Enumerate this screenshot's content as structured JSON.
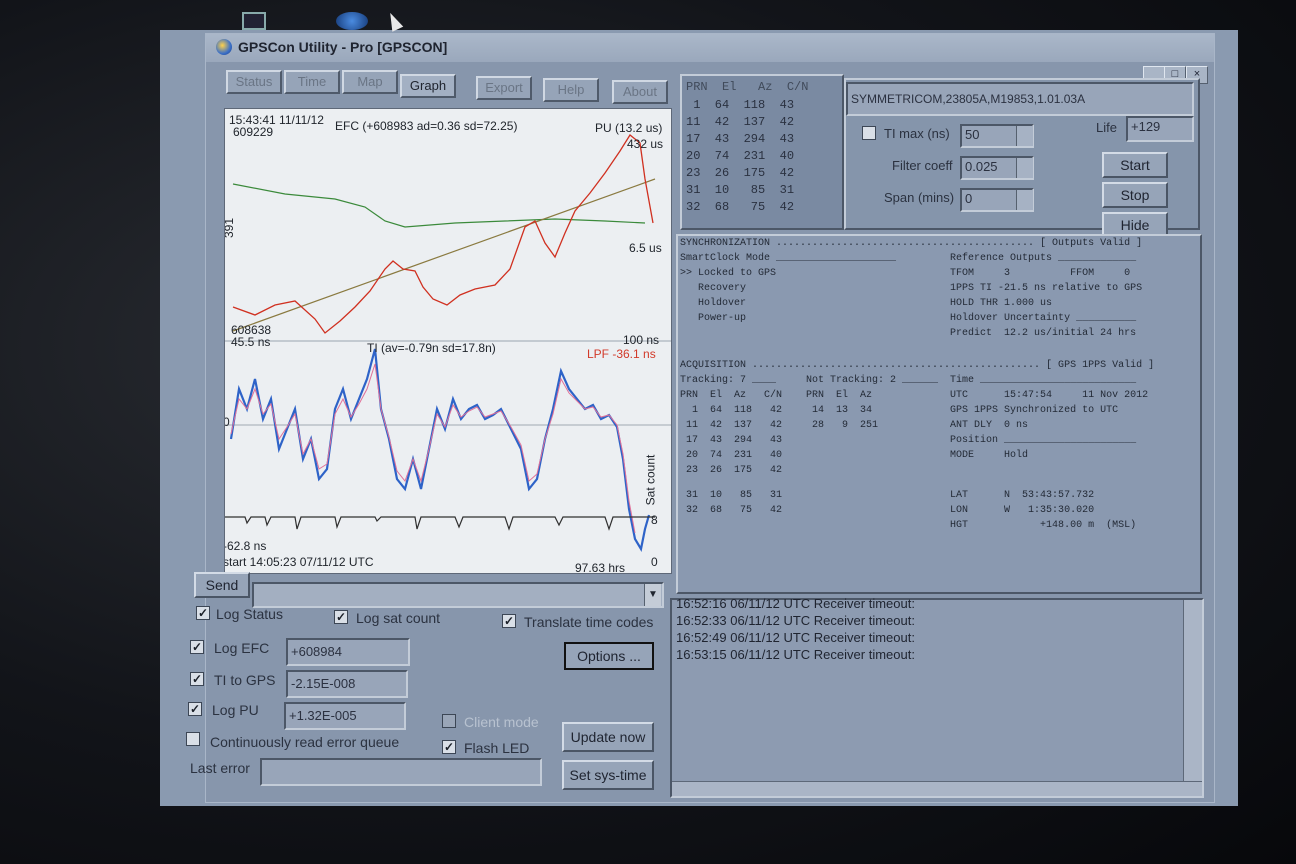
{
  "window": {
    "title": "GPSCon Utility - Pro [GPSCON]",
    "controls": [
      "_",
      "□",
      "×"
    ]
  },
  "tabs": [
    {
      "label": "Status",
      "active": false
    },
    {
      "label": "Time",
      "active": false
    },
    {
      "label": "Map",
      "active": false
    },
    {
      "label": "Graph",
      "active": true
    },
    {
      "label": "Export",
      "active": false
    },
    {
      "label": "Help",
      "active": false
    },
    {
      "label": "About",
      "active": false
    }
  ],
  "graph": {
    "timestamp": "15:43:41 11/11/12",
    "efc_summary": "EFC (+608983 ad=0.36 sd=72.25)",
    "pu_label": "PU (13.2 us)",
    "efc_top": "609229",
    "efc_span": "391",
    "efc_bottom": "608638",
    "pu_top": "432 us",
    "pu_bottom": "6.5 us",
    "ti_top": "45.5 ns",
    "ti_summary": "TI (av=-0.79n sd=17.8n)",
    "ti_top_right": "100 ns",
    "lpf_label": "LPF -36.1 ns",
    "ti_zero": "0",
    "ti_bottom": "-62.8 ns",
    "sat_axis": "Sat count",
    "sat_8": "8",
    "sat_0": "0",
    "start": "start 14:05:23 07/11/12 UTC",
    "duration": "97.63 hrs"
  },
  "sat_table": {
    "header": "PRN  El   Az  C/N",
    "rows": [
      " 1  64  118  43",
      "11  42  137  42",
      "17  43  294  43",
      "20  74  231  40",
      "23  26  175  42",
      "31  10   85  31",
      "32  68   75  42"
    ]
  },
  "device": {
    "id": "SYMMETRICOM,23805A,M19853,1.01.03A",
    "ti_max_label": "TI max (ns)",
    "ti_max_value": "50",
    "filter_label": "Filter coeff",
    "filter_value": "0.025",
    "span_label": "Span (mins)",
    "span_value": "0",
    "life_label": "Life",
    "life_value": "+129",
    "start_label": "Start",
    "stop_label": "Stop",
    "hide_label": "Hide"
  },
  "status_lines": [
    "SYNCHRONIZATION ........................................... [ Outputs Valid ]",
    "SmartClock Mode ____________________         Reference Outputs _____________",
    ">> Locked to GPS                             TFOM     3          FFOM     0",
    "   Recovery                                  1PPS TI -21.5 ns relative to GPS",
    "   Holdover                                  HOLD THR 1.000 us",
    "   Power-up                                  Holdover Uncertainty __________",
    "                                             Predict  12.2 us/initial 24 hrs",
    "",
    "ACQUISITION ................................................ [ GPS 1PPS Valid ]",
    "Tracking: 7 ____     Not Tracking: 2 ______  Time __________________________",
    "PRN  El  Az   C/N    PRN  El  Az             UTC      15:47:54     11 Nov 2012",
    "  1  64  118   42     14  13  34             GPS 1PPS Synchronized to UTC",
    " 11  42  137   42     28   9  251            ANT DLY  0 ns",
    " 17  43  294   43                            Position ______________________",
    " 20  74  231   40                            MODE     Hold",
    " 23  26  175   42",
    " 31  10   85   31                            LAT      N  53:43:57.732",
    " 32  68   75   42                            LON      W   1:35:30.020",
    "                                             HGT            +148.00 m  (MSL)"
  ],
  "controls": {
    "send_label": "Send",
    "log_status": "Log Status",
    "log_sat": "Log sat count",
    "translate": "Translate time codes",
    "options": "Options ...",
    "log_efc": "Log EFC",
    "efc_value": "+608984",
    "ti_gps": "TI to GPS",
    "ti_value": "-2.15E-008",
    "log_pu": "Log PU",
    "pu_value": "+1.32E-005",
    "client_mode": "Client mode",
    "update_now": "Update now",
    "continuous": "Continuously read error queue",
    "flash_led": "Flash LED",
    "last_error": "Last error",
    "set_sys_time": "Set sys-time"
  },
  "log_lines": [
    "16:52:16 06/11/12 UTC Receiver timeout:",
    "16:52:33 06/11/12 UTC Receiver timeout:",
    "16:52:49 06/11/12 UTC Receiver timeout:",
    "16:53:15 06/11/12 UTC Receiver timeout:"
  ]
}
